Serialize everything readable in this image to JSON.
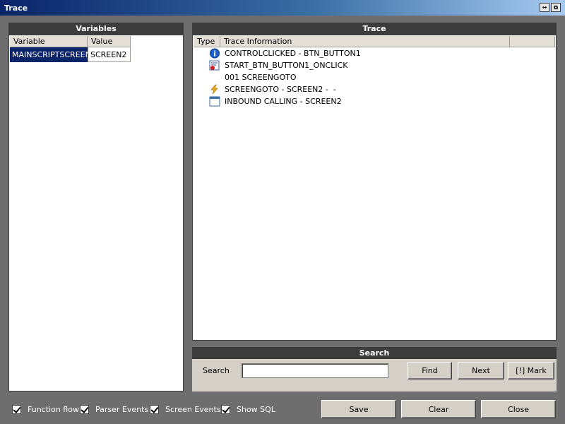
{
  "window": {
    "title": "Trace",
    "controls": [
      "↔",
      "⧉"
    ]
  },
  "variables": {
    "header": "Variables",
    "columns": [
      "Variable",
      "Value"
    ],
    "rows": [
      {
        "variable": "MAINSCRIPTSCREEN",
        "value": "SCREEN2"
      }
    ]
  },
  "trace": {
    "header": "Trace",
    "columns": [
      "Type",
      "Trace Information"
    ],
    "rows": [
      {
        "icon": "info-icon",
        "text": "CONTROLCLICKED - BTN_BUTTON1"
      },
      {
        "icon": "script-icon",
        "text": "START_BTN_BUTTON1_ONCLICK"
      },
      {
        "icon": "",
        "text": "001 SCREENGOTO"
      },
      {
        "icon": "lightning-icon",
        "text": "SCREENGOTO - SCREEN2 -  -"
      },
      {
        "icon": "window-icon",
        "text": "INBOUND CALLING - SCREEN2"
      }
    ]
  },
  "search": {
    "header": "Search",
    "label": "Search",
    "value": "",
    "find_label": "Find",
    "next_label": "Next",
    "mark_label": "[!] Mark"
  },
  "options": [
    {
      "label": "Function flow",
      "checked": true
    },
    {
      "label": "Parser Events",
      "checked": true
    },
    {
      "label": "Screen Events",
      "checked": true
    },
    {
      "label": "Show SQL",
      "checked": true
    }
  ],
  "actions": {
    "save_label": "Save",
    "clear_label": "Clear",
    "close_label": "Close"
  },
  "colors": {
    "background": "#6e6e6e",
    "panel_header": "#3c3c3c",
    "selection": "#0a246a",
    "title_gradient_start": "#0a246a"
  }
}
